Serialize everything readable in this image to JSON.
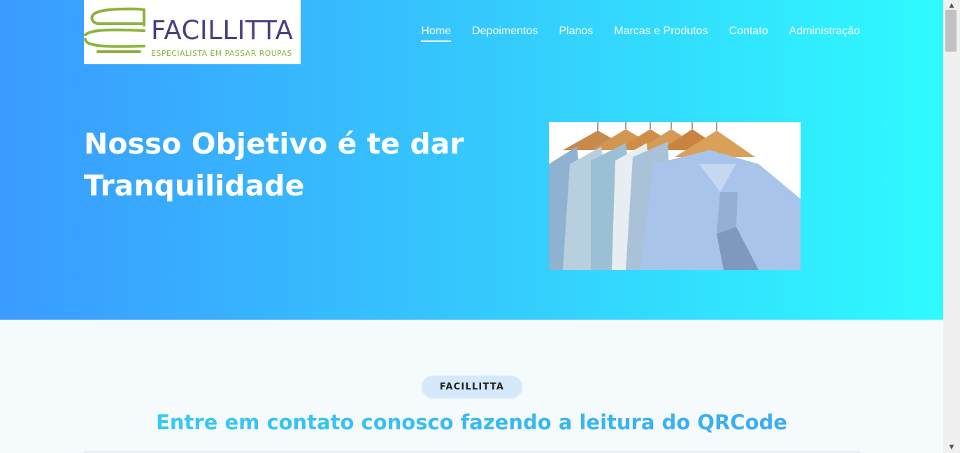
{
  "logo": {
    "name": "FACILLITTA",
    "tagline": "ESPECIALISTA EM PASSAR ROUPAS",
    "colors": {
      "name": "#4a3f82",
      "tagline": "#8cb43c",
      "mark": "#8cb43c"
    }
  },
  "nav": {
    "items": [
      "Home",
      "Depoimentos",
      "Planos",
      "Marcas e Produtos",
      "Contato",
      "Administração"
    ],
    "active": "Home"
  },
  "hero": {
    "title_line1": "Nosso Objetivo é te dar",
    "title_line2": "Tranquilidade",
    "image": "shirts-on-hangers",
    "gradient": [
      "#3a9bff",
      "#2efbff"
    ]
  },
  "section": {
    "badge": "FACILLITTA",
    "title": "Entre em contato conosco fazendo a leitura do QRCode",
    "title_colors": [
      "#38d0f5",
      "#3aa5f2"
    ]
  },
  "scrollbar": {
    "up_icon": "▲",
    "down_icon": "▼"
  }
}
